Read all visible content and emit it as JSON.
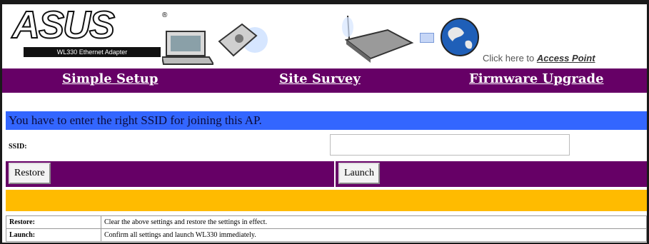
{
  "header": {
    "logo_text": "ASUS",
    "logo_reg": "®",
    "adapter_label": "WL330 Ethernet Adapter",
    "ap_link_prefix": "Click here to ",
    "ap_link_text": "Access Point"
  },
  "nav": {
    "simple_setup": "Simple Setup",
    "site_survey": "Site Survey",
    "firmware_upgrade": "Firmware Upgrade"
  },
  "message": "You have to enter the right SSID for joining this AP.",
  "form": {
    "ssid_label": "SSID:",
    "ssid_value": ""
  },
  "buttons": {
    "restore": "Restore",
    "launch": "Launch"
  },
  "help": [
    {
      "key": "Restore:",
      "desc": "Clear the above settings and restore the settings in effect."
    },
    {
      "key": "Launch:",
      "desc": "Confirm all settings and launch WL330 immediately."
    }
  ],
  "colors": {
    "nav_bg": "#660066",
    "message_bg": "#3366ff",
    "yellow_bar": "#ffbb00"
  }
}
